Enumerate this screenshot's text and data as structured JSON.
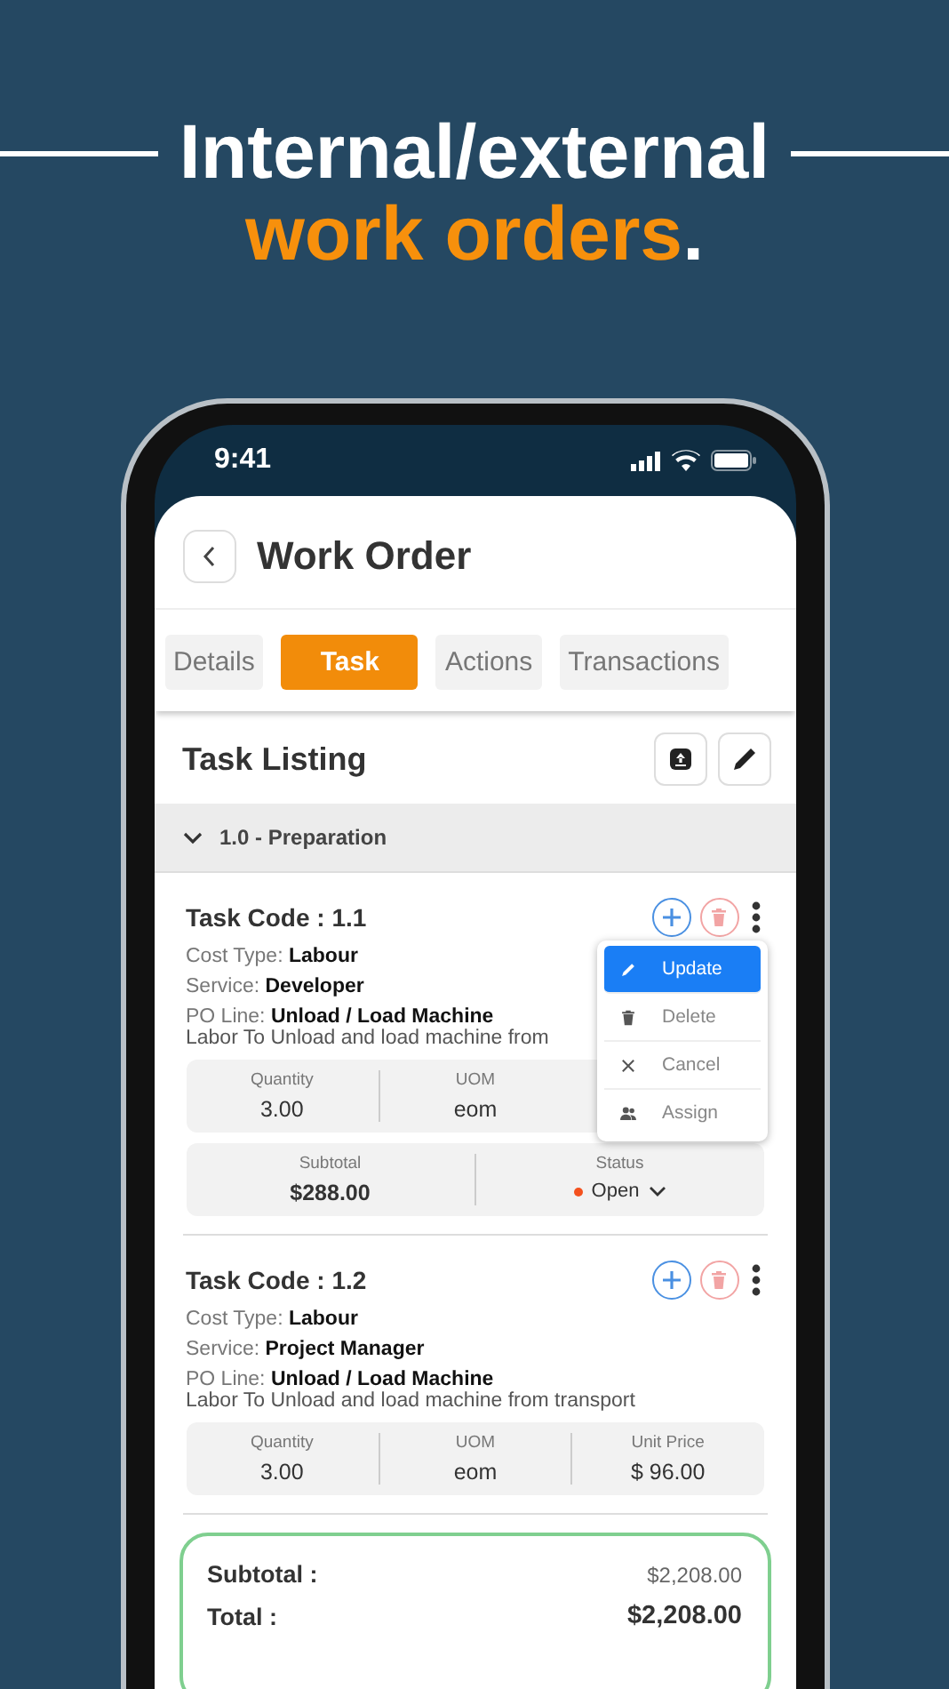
{
  "headline": {
    "line1": "Internal/external",
    "highlight": "work orders",
    "end": "."
  },
  "status_bar": {
    "time": "9:41"
  },
  "header": {
    "title": "Work Order"
  },
  "tabs": [
    {
      "label": "Details",
      "selected": false
    },
    {
      "label": "Task",
      "selected": true
    },
    {
      "label": "Actions",
      "selected": false
    },
    {
      "label": "Transactions",
      "selected": false
    }
  ],
  "listing": {
    "title": "Task Listing"
  },
  "section": {
    "title": "1.0 - Preparation",
    "expanded": true
  },
  "tasks": [
    {
      "code": "Task Code : 1.1",
      "cost_type_label": "Cost Type:",
      "cost_type": "Labour",
      "service_label": "Service:",
      "service": "Developer",
      "po_label": "PO Line:",
      "po_line": "Unload / Load Machine",
      "description": "Labor To Unload and load machine from",
      "stats": [
        {
          "label": "Quantity",
          "value": "3.00"
        },
        {
          "label": "UOM",
          "value": "eom"
        }
      ],
      "subtotal": {
        "label": "Subtotal",
        "value": "$288.00"
      },
      "status": {
        "label": "Status",
        "value": "Open",
        "color": "#f4511e"
      },
      "menu": [
        {
          "kind": "update",
          "label": "Update",
          "selected": true
        },
        {
          "kind": "delete",
          "label": "Delete",
          "selected": false
        },
        {
          "kind": "cancel",
          "label": "Cancel",
          "selected": false
        },
        {
          "kind": "assign",
          "label": "Assign",
          "selected": false
        }
      ]
    },
    {
      "code": "Task Code : 1.2",
      "cost_type_label": "Cost Type:",
      "cost_type": "Labour",
      "service_label": "Service:",
      "service": "Project Manager",
      "po_label": "PO Line:",
      "po_line": "Unload / Load Machine",
      "description": "Labor To Unload and load machine from transport",
      "stats": [
        {
          "label": "Quantity",
          "value": "3.00"
        },
        {
          "label": "UOM",
          "value": "eom"
        },
        {
          "label": "Unit Price",
          "value": "$ 96.00"
        }
      ]
    }
  ],
  "summary": {
    "subtotal_label": "Subtotal :",
    "subtotal": "$2,208.00",
    "total_label": "Total :",
    "total": "$2,208.00"
  }
}
